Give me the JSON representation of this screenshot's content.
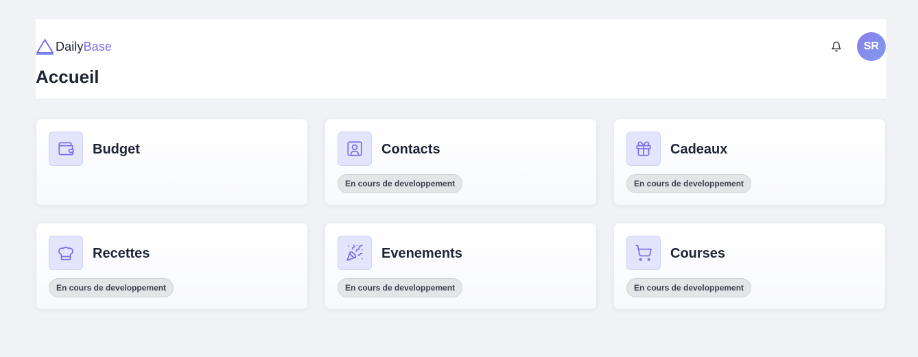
{
  "app": {
    "logo_part1": "Daily",
    "logo_part2": "Base",
    "accent_color": "#7c6ee6"
  },
  "header": {
    "title": "Accueil",
    "notification_icon": "bell-icon",
    "avatar_initials": "SR"
  },
  "cards": [
    {
      "title": "Budget",
      "icon": "wallet-icon",
      "badge": ""
    },
    {
      "title": "Contacts",
      "icon": "contact-card-icon",
      "badge": "En cours de developpement"
    },
    {
      "title": "Cadeaux",
      "icon": "gift-icon",
      "badge": "En cours de developpement"
    },
    {
      "title": "Recettes",
      "icon": "chef-hat-icon",
      "badge": "En cours de developpement"
    },
    {
      "title": "Evenements",
      "icon": "party-popper-icon",
      "badge": "En cours de developpement"
    },
    {
      "title": "Courses",
      "icon": "shopping-cart-icon",
      "badge": "En cours de developpement"
    }
  ]
}
